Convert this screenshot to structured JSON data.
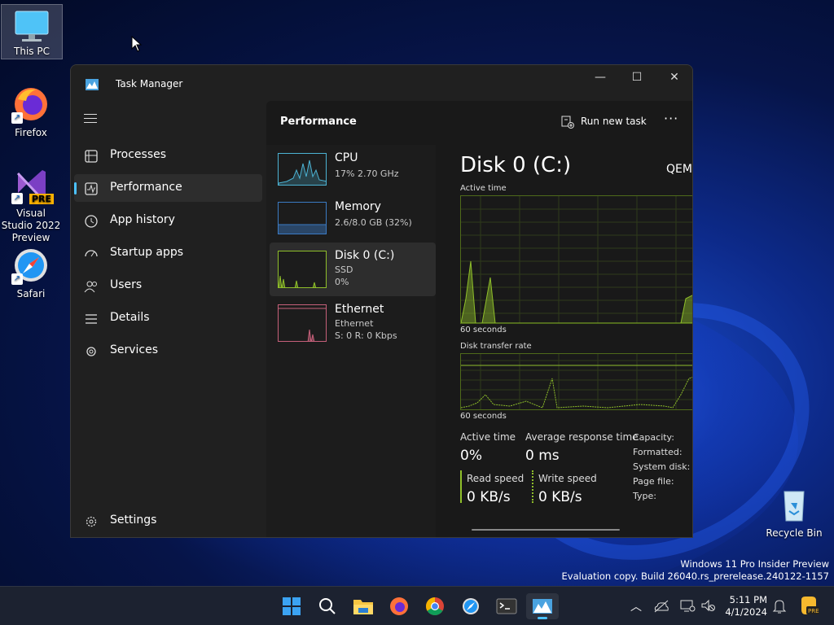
{
  "desktop": {
    "icons": [
      {
        "label": "This PC",
        "icon": "monitor-icon"
      },
      {
        "label": "Firefox",
        "icon": "firefox-icon"
      },
      {
        "label": "Visual Studio 2022 Preview",
        "icon": "visual-studio-icon",
        "badge": "PRE"
      },
      {
        "label": "Safari",
        "icon": "safari-icon"
      },
      {
        "label": "Recycle Bin",
        "icon": "recycle-bin-icon"
      }
    ]
  },
  "window": {
    "title": "Task Manager",
    "controls": {
      "minimize": "—",
      "maximize": "☐",
      "close": "✕"
    }
  },
  "nav": {
    "items": [
      {
        "label": "Processes",
        "icon": "processes-icon"
      },
      {
        "label": "Performance",
        "icon": "performance-icon",
        "active": true
      },
      {
        "label": "App history",
        "icon": "app-history-icon"
      },
      {
        "label": "Startup apps",
        "icon": "startup-apps-icon"
      },
      {
        "label": "Users",
        "icon": "users-icon"
      },
      {
        "label": "Details",
        "icon": "details-icon"
      },
      {
        "label": "Services",
        "icon": "services-icon"
      }
    ],
    "settings": "Settings"
  },
  "header": {
    "title": "Performance",
    "run_new_task": "Run new task",
    "more": "···"
  },
  "perf_list": [
    {
      "name": "CPU",
      "line1": "17%  2.70 GHz",
      "line2": "",
      "color": "#4cb3d4"
    },
    {
      "name": "Memory",
      "line1": "2.6/8.0 GB (32%)",
      "line2": "",
      "color": "#3b7bc4"
    },
    {
      "name": "Disk 0 (C:)",
      "line1": "SSD",
      "line2": "0%",
      "color": "#8fbf2a",
      "active": true
    },
    {
      "name": "Ethernet",
      "line1": "Ethernet",
      "line2": "S: 0  R: 0 Kbps",
      "color": "#c6607a"
    }
  ],
  "detail": {
    "title": "Disk 0 (C:)",
    "model": "QEM",
    "graph1_label": "Active time",
    "graph1_footer": "60 seconds",
    "graph2_label": "Disk transfer rate",
    "graph2_footer": "60 seconds",
    "active_time_label": "Active time",
    "active_time_value": "0%",
    "avg_response_label": "Average response time",
    "avg_response_value": "0 ms",
    "read_speed_label": "Read speed",
    "read_speed_value": "0 KB/s",
    "write_speed_label": "Write speed",
    "write_speed_value": "0 KB/s",
    "side_labels": [
      "Capacity:",
      "Formatted:",
      "System disk:",
      "Page file:",
      "Type:"
    ]
  },
  "watermark": {
    "line1": "Windows 11 Pro Insider Preview",
    "line2": "Evaluation copy. Build 26040.rs_prerelease.240122-1157"
  },
  "taskbar": {
    "apps": [
      "start-icon",
      "search-icon",
      "file-explorer-icon",
      "firefox-icon",
      "chrome-icon",
      "safari-icon",
      "terminal-icon",
      "task-manager-icon"
    ],
    "time": "5:11 PM",
    "date": "4/1/2024"
  }
}
